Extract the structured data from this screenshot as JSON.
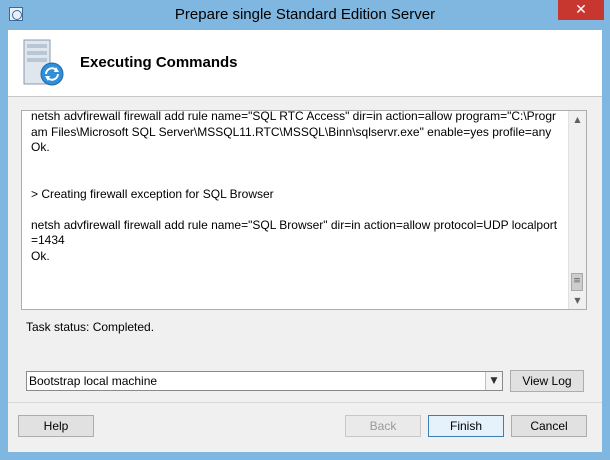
{
  "window": {
    "title": "Prepare single Standard Edition Server",
    "close_glyph": "✕"
  },
  "header": {
    "title": "Executing Commands",
    "icon": "server-refresh-icon"
  },
  "log": {
    "text": "netsh advfirewall firewall add rule name=\"SQL RTC Access\" dir=in action=allow program=\"C:\\Program Files\\Microsoft SQL Server\\MSSQL11.RTC\\MSSQL\\Binn\\sqlservr.exe\" enable=yes profile=any\nOk.\n\n\n> Creating firewall exception for SQL Browser\n\nnetsh advfirewall firewall add rule name=\"SQL Browser\" dir=in action=allow protocol=UDP localport=1434\nOk."
  },
  "status": {
    "text": "Task status: Completed."
  },
  "log_selector": {
    "selected": "Bootstrap local machine"
  },
  "buttons": {
    "view_log": "View Log",
    "help": "Help",
    "back": "Back",
    "finish": "Finish",
    "cancel": "Cancel"
  },
  "colors": {
    "titlebar": "#7fb7e0",
    "close": "#c7372f",
    "client_bg": "#f0f0f0"
  }
}
